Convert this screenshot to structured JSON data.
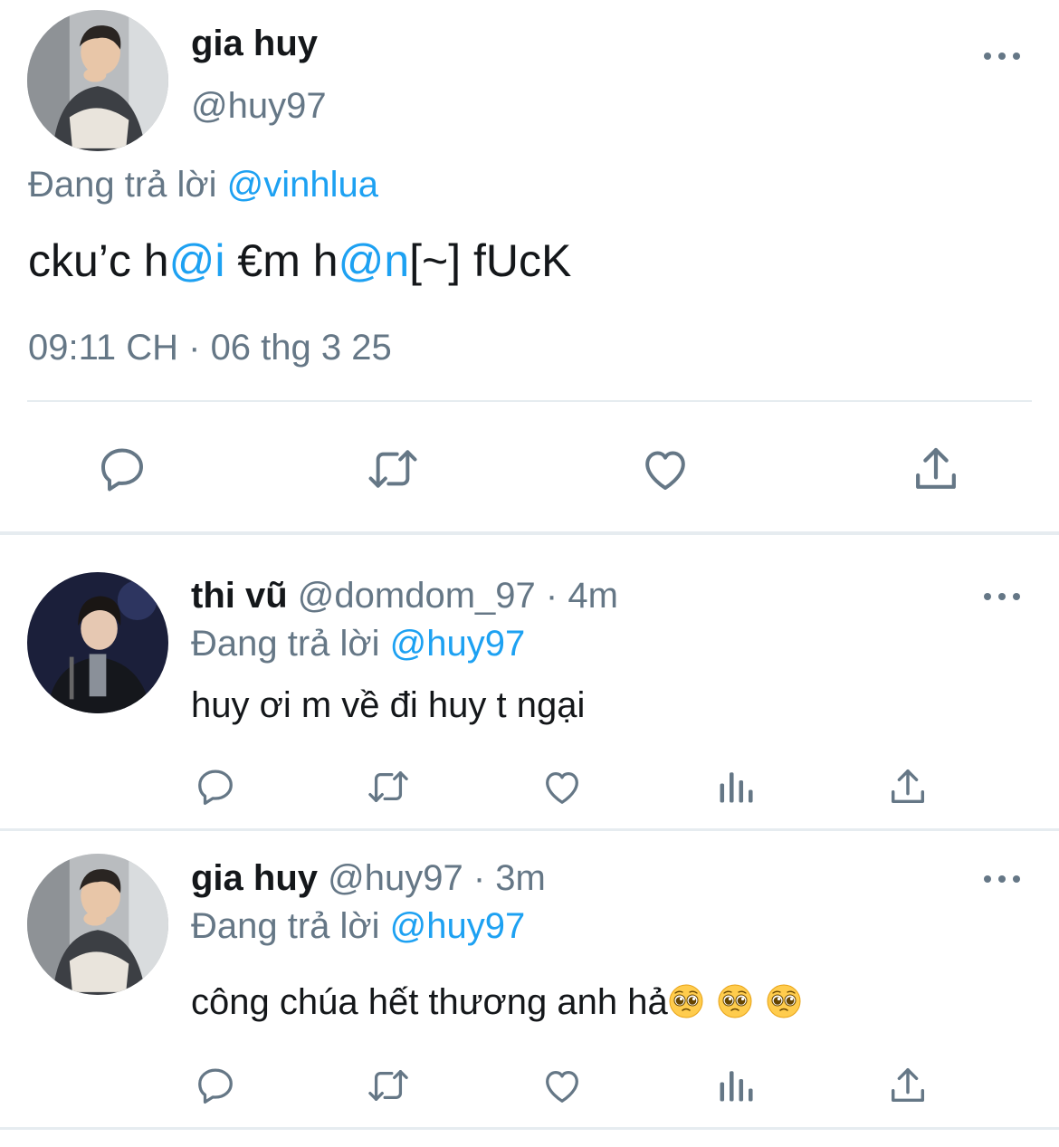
{
  "main_tweet": {
    "display_name": "gia huy",
    "handle": "@huy97",
    "reply_prefix": "Đang trả lời",
    "reply_to": "@vinhlua",
    "text_parts": [
      {
        "text": "cku’c h",
        "style": "normal"
      },
      {
        "text": "@i",
        "style": "link"
      },
      {
        "text": " €m h",
        "style": "normal"
      },
      {
        "text": "@n",
        "style": "link"
      },
      {
        "text": "[~] fUcK",
        "style": "normal"
      }
    ],
    "timestamp": "09:11 CH · 06 thg 3 25",
    "actions": [
      "reply-icon",
      "retweet-icon",
      "like-icon",
      "share-icon"
    ]
  },
  "replies": [
    {
      "display_name": "thi vũ",
      "handle": "@domdom_97",
      "time": "· 4m",
      "reply_prefix": "Đang trả lời",
      "reply_to": "@huy97",
      "text": "huy ơi m về đi huy t ngại",
      "emojis": [],
      "actions": [
        "reply-icon",
        "retweet-icon",
        "like-icon",
        "analytics-icon",
        "share-icon"
      ]
    },
    {
      "display_name": "gia huy",
      "handle": "@huy97",
      "time": "· 3m",
      "reply_prefix": "Đang trả lời",
      "reply_to": "@huy97",
      "text": "công chúa hết thương anh hả",
      "emojis": [
        "pleading-face-emoji",
        "pleading-face-emoji",
        "pleading-face-emoji"
      ],
      "actions": [
        "reply-icon",
        "retweet-icon",
        "like-icon",
        "analytics-icon",
        "share-icon"
      ]
    }
  ],
  "colors": {
    "accent": "#1da1f2",
    "muted": "#657786",
    "text": "#14171a",
    "divider": "#e6ecf0"
  }
}
